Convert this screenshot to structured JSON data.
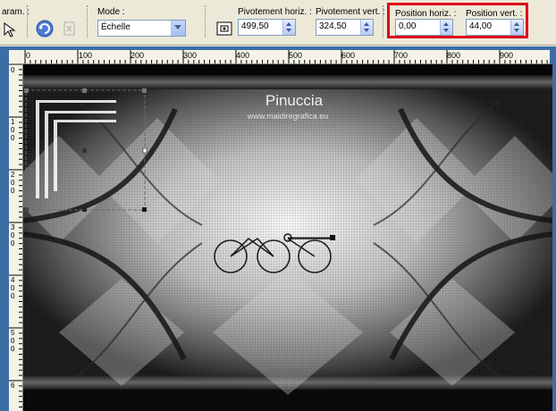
{
  "toolbar": {
    "param_label": "aram. :",
    "mode_label": "Mode :",
    "mode_value": "Échelle",
    "pivot_h_label": "Pivotement horiz. :",
    "pivot_h_value": "499,50",
    "pivot_v_label": "Pivotement vert. :",
    "pivot_v_value": "324,50",
    "pos_h_label": "Position horiz. :",
    "pos_h_value": "0,00",
    "pos_v_label": "Position vert. :",
    "pos_v_value": "44,00"
  },
  "ruler": {
    "h_ticks": [
      "0",
      "100",
      "200",
      "300",
      "400",
      "500",
      "600",
      "700",
      "800",
      "900"
    ],
    "v_ticks": [
      "0",
      "1\n0\n0",
      "2\n0\n0",
      "3\n0\n0",
      "4\n0\n0",
      "5\n0\n0",
      "6"
    ]
  },
  "canvas": {
    "watermark_title": "Pinuccia",
    "watermark_url": "www.maidiregrafica.eu"
  },
  "colors": {
    "highlight": "#e0001a",
    "toolbar_bg": "#ece9d8",
    "frame_bg": "#3a6ea5"
  }
}
